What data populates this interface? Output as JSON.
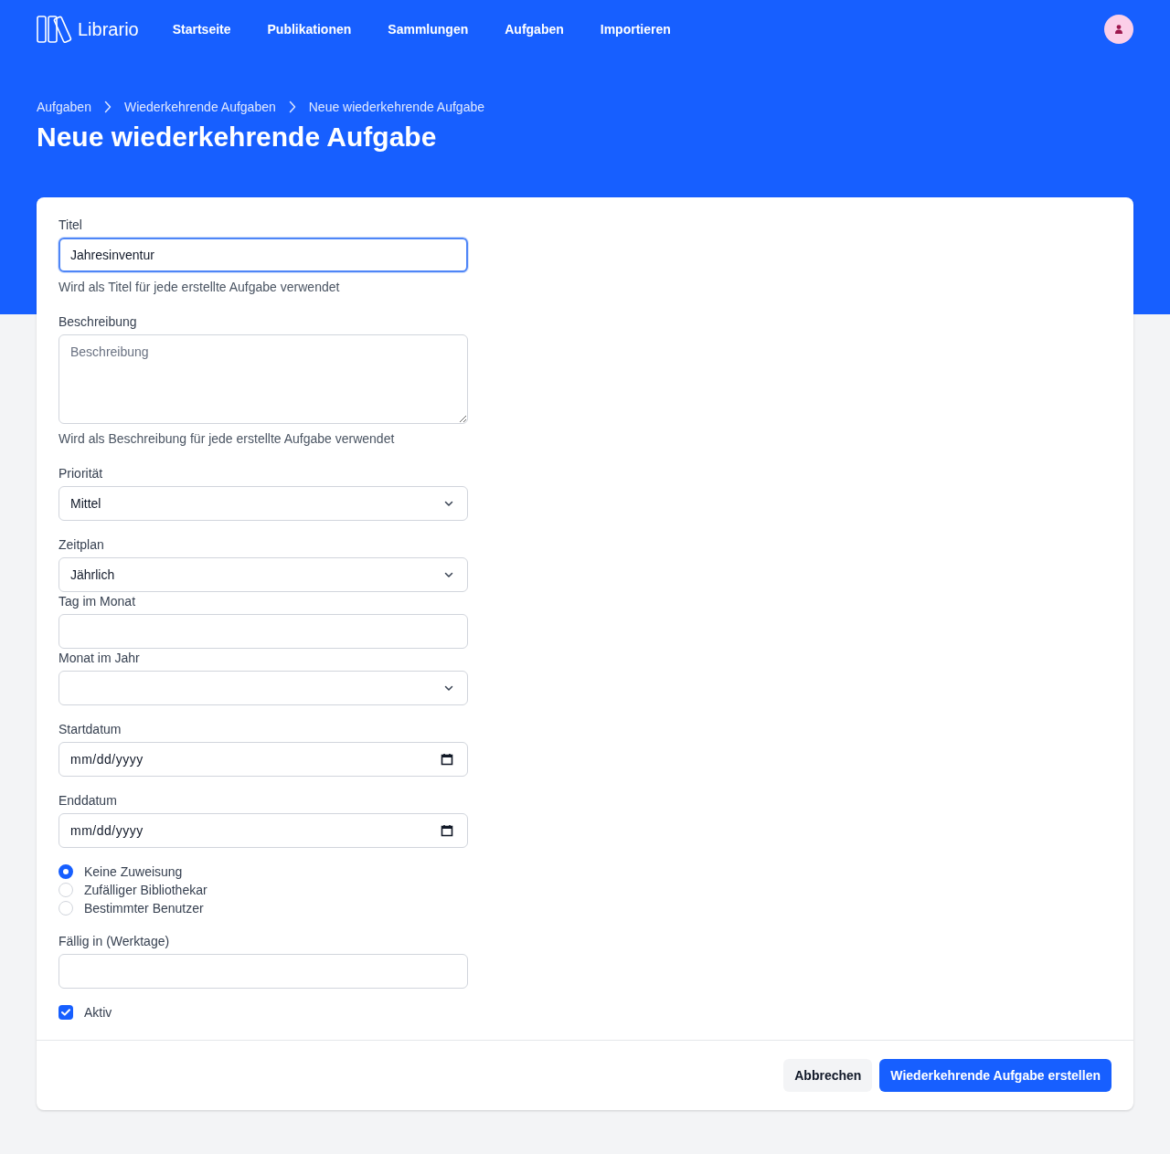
{
  "nav": {
    "brand": "Librario",
    "links": [
      {
        "label": "Startseite"
      },
      {
        "label": "Publikationen"
      },
      {
        "label": "Sammlungen"
      },
      {
        "label": "Aufgaben"
      },
      {
        "label": "Importieren"
      }
    ]
  },
  "breadcrumb": [
    {
      "label": "Aufgaben"
    },
    {
      "label": "Wiederkehrende Aufgaben"
    },
    {
      "label": "Neue wiederkehrende Aufgabe"
    }
  ],
  "page_title": "Neue wiederkehrende Aufgabe",
  "form": {
    "fields": [
      {
        "kind": "text",
        "label": "Titel",
        "value": "Jahresinventur",
        "focused": true,
        "help": "Wird als Titel für jede erstellte Aufgabe verwendet"
      },
      {
        "kind": "textarea",
        "label": "Beschreibung",
        "placeholder": "Beschreibung",
        "focused": false,
        "help": "Wird als Beschreibung für jede erstellte Aufgabe verwendet"
      },
      {
        "kind": "select",
        "label": "Priorität",
        "value": "Mittel",
        "focused": false
      },
      {
        "kind": "select",
        "label": "Zeitplan",
        "value": "Jährlich",
        "focused": false,
        "sub_fields": [
          {
            "kind": "text",
            "label": "Tag im Monat",
            "focused": false
          },
          {
            "kind": "select",
            "label": "Monat im Jahr",
            "focused": false
          }
        ]
      },
      {
        "kind": "date",
        "label": "Startdatum",
        "placeholder": "mm/dd/yyyy",
        "focused": false
      },
      {
        "kind": "date",
        "label": "Enddatum",
        "placeholder": "mm/dd/yyyy",
        "focused": false
      },
      {
        "kind": "radio_group",
        "options": [
          {
            "label": "Keine Zuweisung",
            "selected": true
          },
          {
            "label": "Zufälliger Bibliothekar",
            "selected": false
          },
          {
            "label": "Bestimmter Benutzer",
            "selected": false
          }
        ]
      },
      {
        "kind": "text",
        "label": "Fällig in (Werktage)",
        "focused": false
      },
      {
        "kind": "checkbox",
        "label": "Aktiv",
        "checked": true
      }
    ]
  },
  "actions": [
    {
      "kind": "secondary",
      "label": "Abbrechen"
    },
    {
      "kind": "primary",
      "label": "Wiederkehrende Aufgabe erstellen"
    }
  ]
}
